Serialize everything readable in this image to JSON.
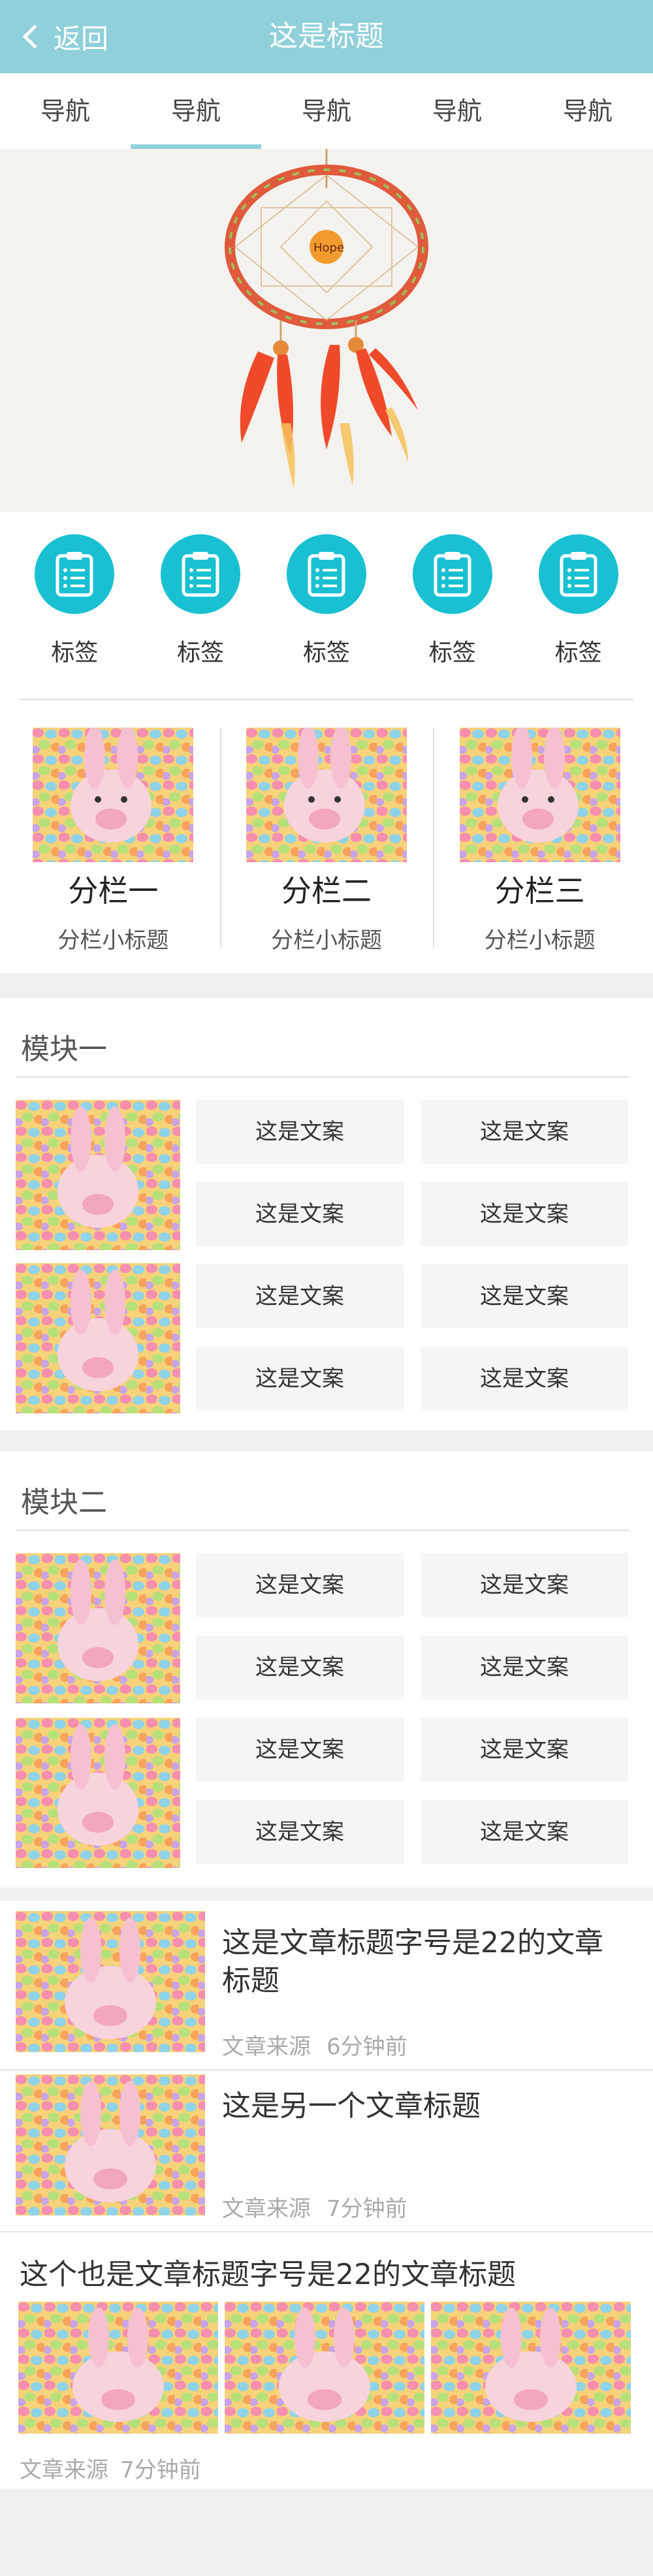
{
  "header": {
    "back_label": "返回",
    "title": "这是标题"
  },
  "tabs": [
    "导航",
    "导航",
    "导航",
    "导航",
    "导航"
  ],
  "icon_items": [
    "标签",
    "标签",
    "标签",
    "标签",
    "标签"
  ],
  "columns": [
    {
      "title": "分栏一",
      "subtitle": "分栏小标题"
    },
    {
      "title": "分栏二",
      "subtitle": "分栏小标题"
    },
    {
      "title": "分栏三",
      "subtitle": "分栏小标题"
    }
  ],
  "modules": [
    {
      "title": "模块一",
      "buttons": [
        "这是文案",
        "这是文案",
        "这是文案",
        "这是文案",
        "这是文案",
        "这是文案",
        "这是文案",
        "这是文案"
      ]
    },
    {
      "title": "模块二",
      "buttons": [
        "这是文案",
        "这是文案",
        "这是文案",
        "这是文案",
        "这是文案",
        "这是文案",
        "这是文案",
        "这是文案"
      ]
    }
  ],
  "articles": [
    {
      "title": "这是文章标题字号是22的文章标题",
      "source": "文章来源",
      "time": "6分钟前"
    },
    {
      "title": "这是另一个文章标题",
      "source": "文章来源",
      "time": "7分钟前"
    },
    {
      "title": "这个也是文章标题字号是22的文章标题",
      "source": "文章来源",
      "time": "7分钟前"
    }
  ],
  "banner": {
    "charm_text": "Hope"
  },
  "colors": {
    "header": "#8fd0da",
    "icon_circle": "#18c0d2",
    "tab_indicator": "#8fd0da"
  }
}
